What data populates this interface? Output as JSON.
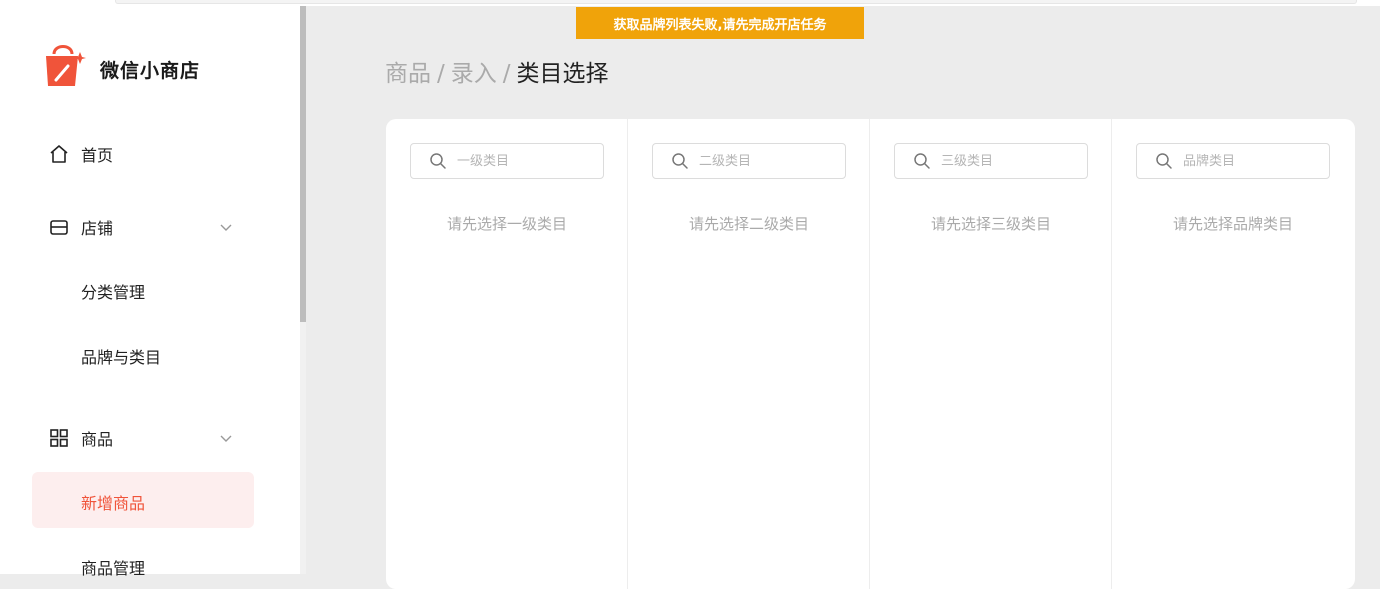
{
  "app": {
    "name": "微信小商店"
  },
  "toast": {
    "message": "获取品牌列表失败,请先完成开店任务"
  },
  "sidebar": {
    "home": "首页",
    "store": "店铺",
    "store_children": [
      "分类管理",
      "品牌与类目"
    ],
    "goods": "商品",
    "goods_children": [
      "新增商品",
      "商品管理"
    ]
  },
  "breadcrumb": [
    "商品",
    "录入",
    "类目选择"
  ],
  "columns": [
    {
      "placeholder": "一级类目",
      "hint": "请先选择一级类目"
    },
    {
      "placeholder": "二级类目",
      "hint": "请先选择二级类目"
    },
    {
      "placeholder": "三级类目",
      "hint": "请先选择三级类目"
    },
    {
      "placeholder": "品牌类目",
      "hint": "请先选择品牌类目"
    }
  ],
  "colors": {
    "brand": "#f0543a",
    "toast": "#f0a30a",
    "active_bg": "#fdeeee"
  }
}
